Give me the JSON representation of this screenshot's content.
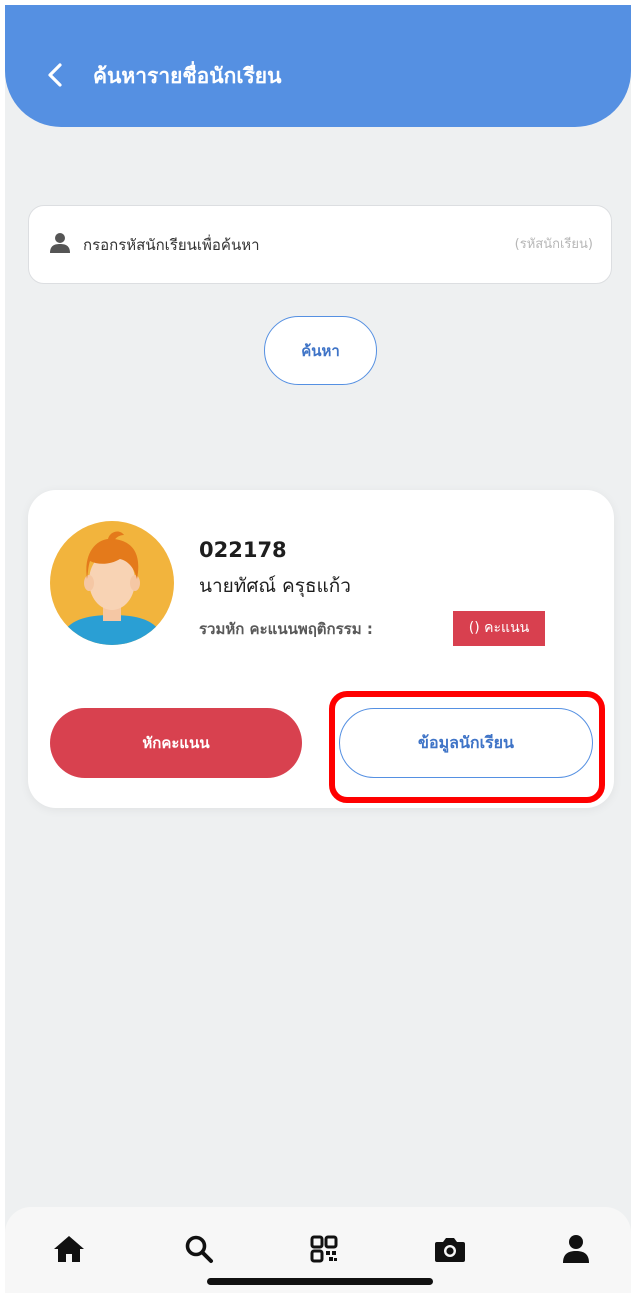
{
  "header": {
    "title": "ค้นหารายชื่อนักเรียน",
    "background_color": "#5590e2",
    "back_icon": "chevron-left-icon"
  },
  "search": {
    "placeholder": "กรอกรหัสนักเรียนเพื่อค้นหา",
    "hint": "(รหัสนักเรียน)",
    "field_icon": "user-icon",
    "button_label": "ค้นหา"
  },
  "student": {
    "id": "022178",
    "name": "นายทัศณ์ ครุธแก้ว",
    "score_label": "รวมหัก คะแนนพฤติกรรม :",
    "score_badge": "() คะแนน",
    "avatar_icon": "student-avatar"
  },
  "actions": {
    "deduct_label": "หักคะแนน",
    "info_label": "ข้อมูลนักเรียน",
    "deduct_color": "#d8414f",
    "accent_color": "#5590e2",
    "highlight_color": "#ff0000"
  },
  "tab_bar": {
    "items": [
      {
        "icon": "home-icon"
      },
      {
        "icon": "search-icon"
      },
      {
        "icon": "qr-code-icon"
      },
      {
        "icon": "camera-icon"
      },
      {
        "icon": "profile-icon"
      }
    ]
  }
}
